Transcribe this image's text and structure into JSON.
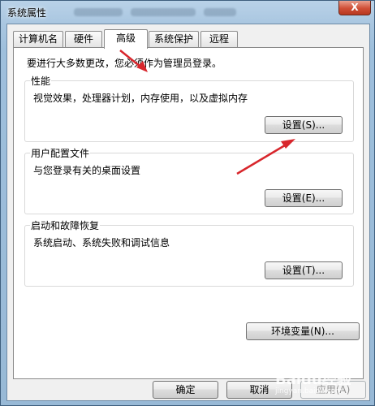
{
  "window": {
    "title": "系统属性",
    "close_label": "X"
  },
  "tabs": [
    {
      "label": "计算机名"
    },
    {
      "label": "硬件"
    },
    {
      "label": "高级"
    },
    {
      "label": "系统保护"
    },
    {
      "label": "远程"
    }
  ],
  "active_tab": "高级",
  "intro": "要进行大多数更改，您必须作为管理员登录。",
  "groups": {
    "performance": {
      "title": "性能",
      "desc": "视觉效果，处理器计划，内存使用，以及虚拟内存",
      "button": "设置(S)..."
    },
    "profile": {
      "title": "用户配置文件",
      "desc": "与您登录有关的桌面设置",
      "button": "设置(E)..."
    },
    "startup": {
      "title": "启动和故障恢复",
      "desc": "系统启动、系统失败和调试信息",
      "button": "设置(T)..."
    }
  },
  "env_button": "环境变量(N)...",
  "footer": {
    "ok": "确定",
    "cancel": "取消",
    "apply": "应用(A)"
  },
  "watermark": {
    "text": "Baidu经验",
    "sub": "jingyan.baidu.com"
  },
  "colors": {
    "annotation_arrow": "#d8262c",
    "window_frame": "#a9c6e0"
  }
}
